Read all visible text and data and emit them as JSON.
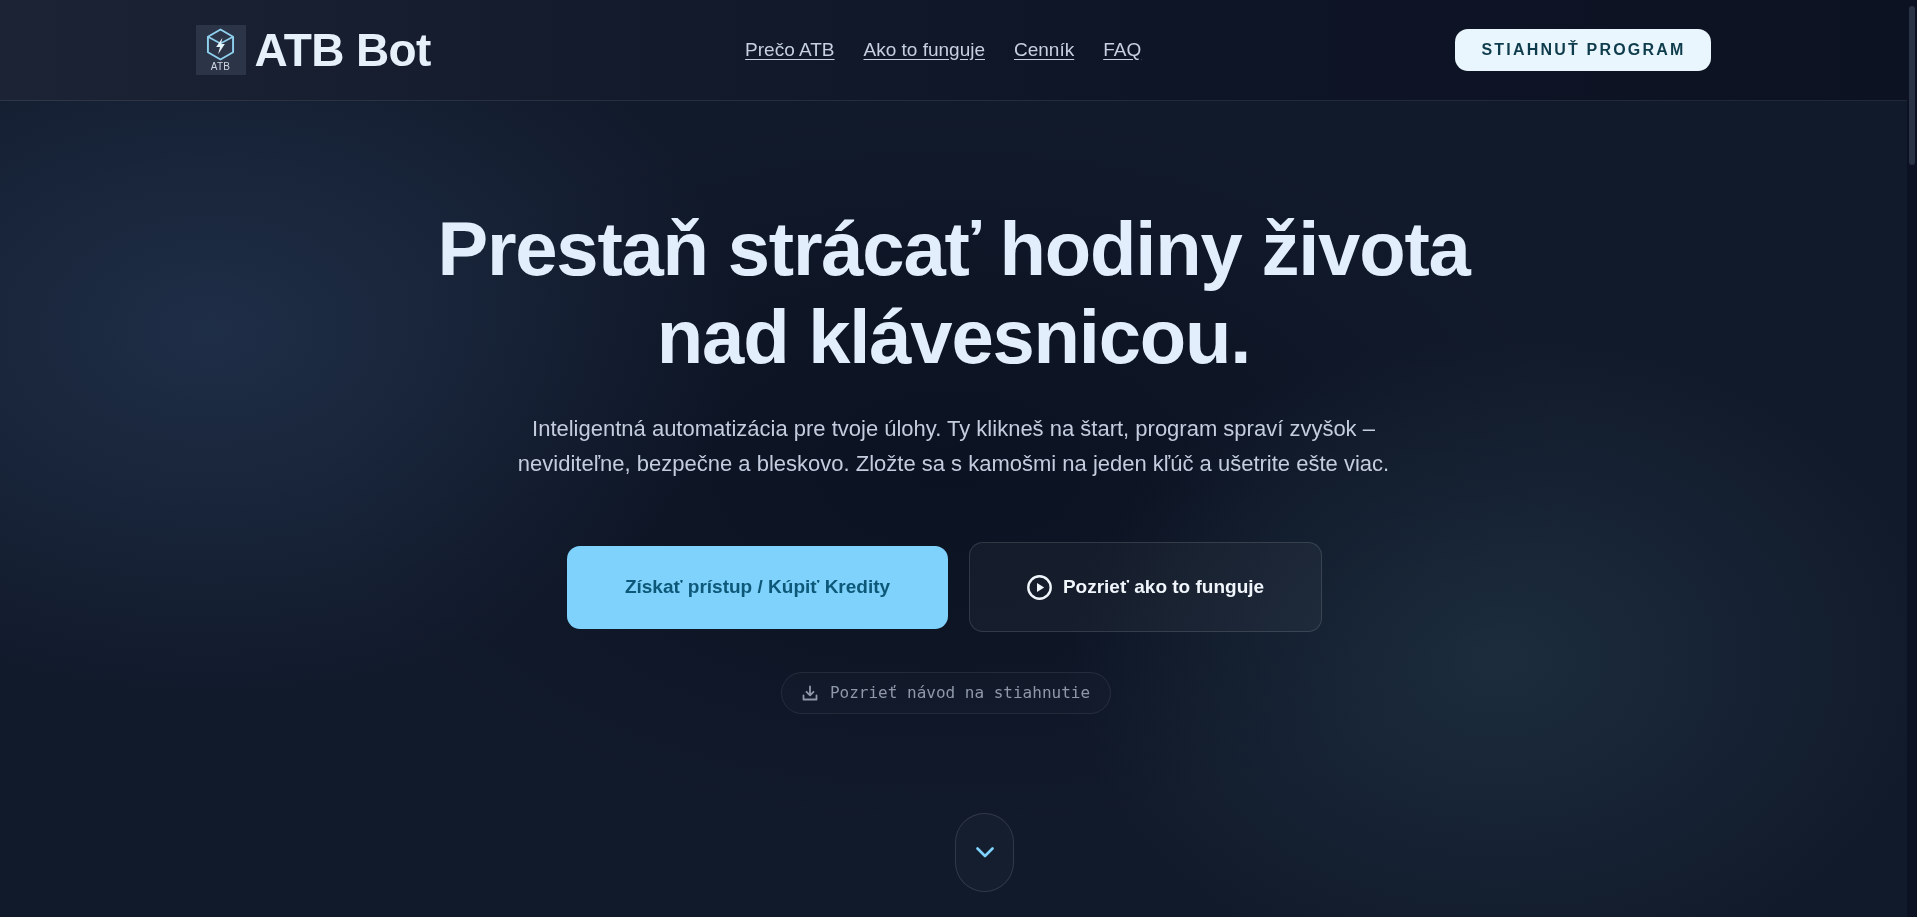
{
  "header": {
    "logo": {
      "badge": "ATB",
      "name": "ATB Bot"
    },
    "nav_links": [
      "Prečo ATB",
      "Ako to funguje",
      "Cenník",
      "FAQ"
    ],
    "download_button": "STIAHNUŤ PROGRAM"
  },
  "hero": {
    "title": "Prestaň strácať hodiny života nad klávesnicou.",
    "subtitle": "Inteligentná automatizácia pre tvoje úlohy. Ty klikneš na štart, program spraví zvyšok – neviditeľne, bezpečne a bleskovo. Zložte sa s kamošmi na jeden kľúč a ušetrite ešte viac.",
    "buttons": [
      {
        "label": "Získať prístup / Kúpiť Kredity",
        "kind": "primary"
      },
      {
        "label": "Pozrieť ako to funguje",
        "kind": "video"
      }
    ],
    "guide_link": "Pozrieť návod na stiahnutie"
  }
}
